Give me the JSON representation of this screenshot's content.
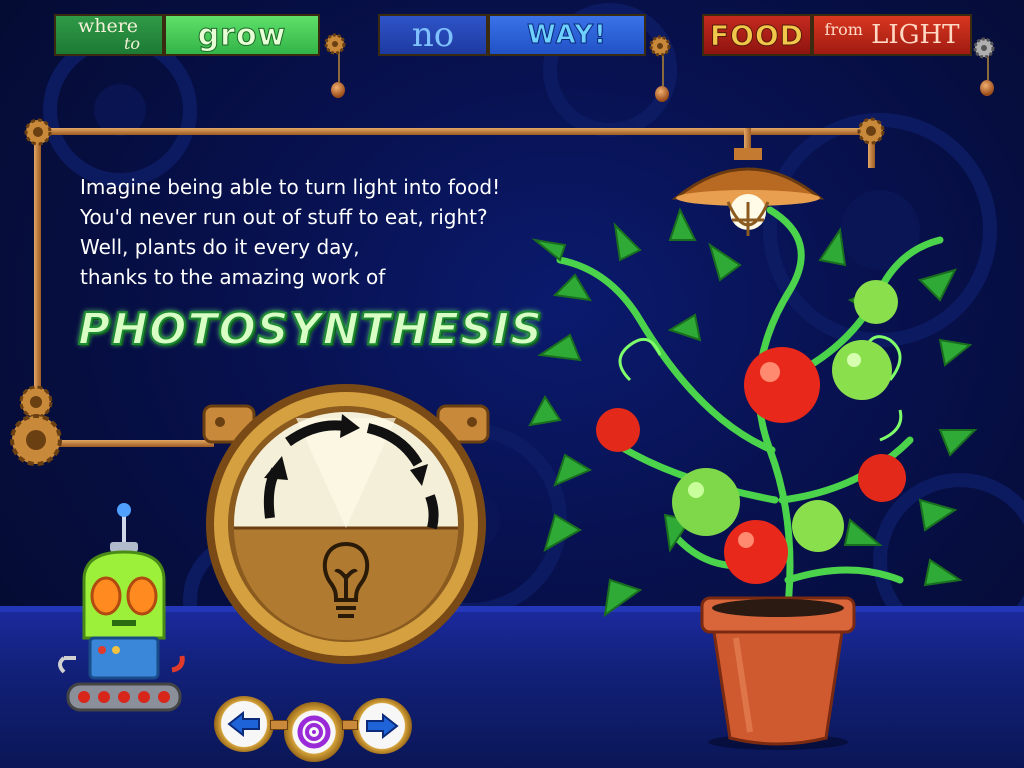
{
  "header": {
    "tabs": [
      {
        "label_small": "where",
        "label_sub": "to",
        "label_big": "grow"
      },
      {
        "label_small": "no",
        "label_big": "WAY!"
      },
      {
        "label_small": "FOOD",
        "label_sub": "from",
        "label_big": "LIGHT"
      }
    ]
  },
  "main": {
    "intro_lines": [
      "Imagine being able to turn light into food!",
      "You'd never run out of stuff to eat, right?",
      "Well, plants do it every day,",
      "thanks to the amazing work of"
    ],
    "headline": "PHOTOSYNTHESIS"
  },
  "icons": {
    "gauge": "lightbulb-icon",
    "nav_left": "arrow-left-icon",
    "nav_home": "spiral-home-icon",
    "nav_right": "arrow-right-icon"
  },
  "colors": {
    "background": "#07104a",
    "floor": "#12217a",
    "brass": "#c88a3a",
    "headline_green": "#1f8a34"
  }
}
